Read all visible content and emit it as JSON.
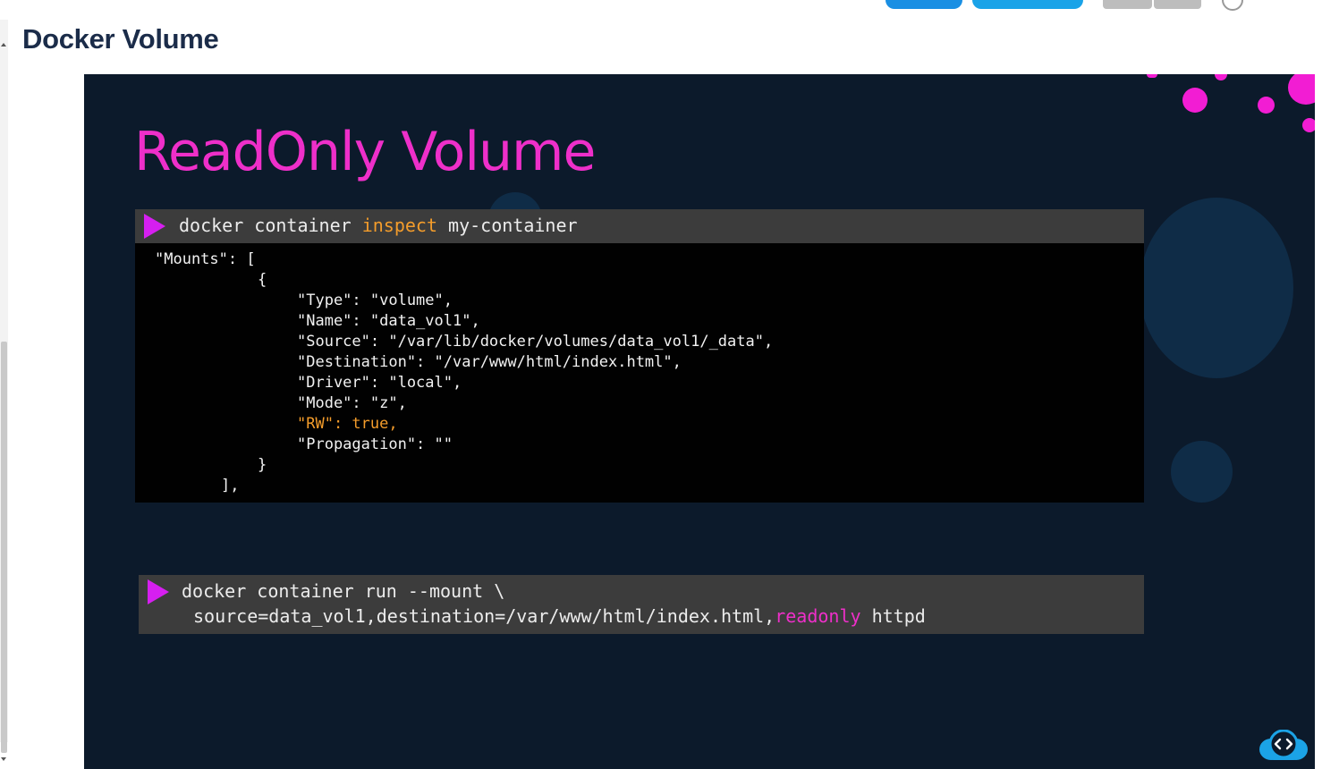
{
  "page": {
    "title": "Docker Volume"
  },
  "slide": {
    "title": "ReadOnly Volume",
    "inspect_command": {
      "pre": "docker container ",
      "keyword": "inspect",
      "post": " my-container"
    },
    "mounts_output": {
      "open": "\"Mounts\": [",
      "brace_open": "{",
      "fields": [
        "\"Type\": \"volume\",",
        "\"Name\": \"data_vol1\",",
        "\"Source\": \"/var/lib/docker/volumes/data_vol1/_data\",",
        "\"Destination\": \"/var/www/html/index.html\",",
        "\"Driver\": \"local\",",
        "\"Mode\": \"z\","
      ],
      "rw_field": "\"RW\": true,",
      "propagation_field": "\"Propagation\": \"\"",
      "brace_close": "}",
      "close": "],"
    },
    "run_command": {
      "line1": "docker container run --mount \\",
      "line2_pre": "source=data_vol1,destination=/var/www/html/index.html,",
      "line2_keyword": "readonly",
      "line2_post": " httpd"
    }
  },
  "colors": {
    "slide_bg": "#0c1a2b",
    "accent_pink": "#ee2fc9",
    "accent_orange": "#f39c2b",
    "play_icon": "#d61ff0"
  },
  "icons": [
    "play-icon",
    "cloud-code-logo-icon",
    "help-icon"
  ]
}
